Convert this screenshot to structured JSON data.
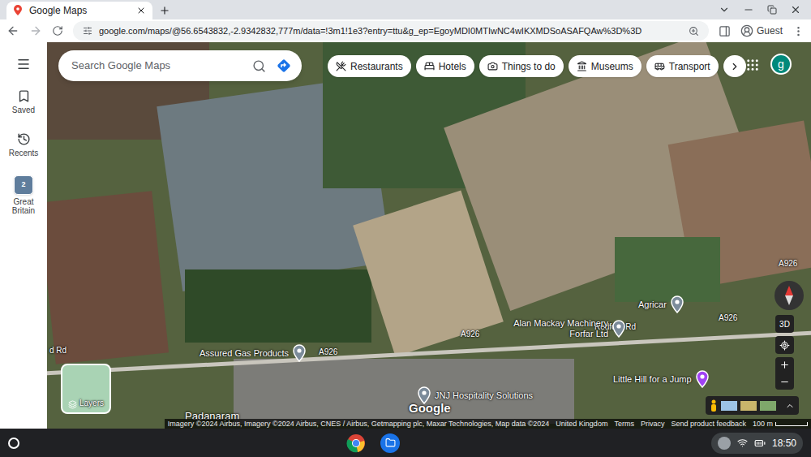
{
  "browser": {
    "tab_title": "Google Maps",
    "url": "google.com/maps/@56.6543832,-2.9342832,777m/data=!3m1!1e3?entry=ttu&g_ep=EgoyMDI0MTIwNC4wIKXMDSoASAFQAw%3D%3D",
    "profile": "Guest"
  },
  "sidebar": {
    "items": [
      {
        "label": "Saved",
        "kind": "saved"
      },
      {
        "label": "Recents",
        "kind": "recents"
      },
      {
        "label": "Great Britain",
        "kind": "place",
        "badge": "2"
      }
    ]
  },
  "search": {
    "placeholder": "Search Google Maps"
  },
  "chips": [
    {
      "label": "Restaurants"
    },
    {
      "label": "Hotels"
    },
    {
      "label": "Things to do"
    },
    {
      "label": "Museums"
    },
    {
      "label": "Transport"
    }
  ],
  "account_initial": "g",
  "places": [
    {
      "name": "Agricar",
      "color": "#7b8b9a"
    },
    {
      "name": "Alan Mackay Machinery Forfar Ltd",
      "color": "#7b8b9a"
    },
    {
      "name": "Assured Gas Products",
      "color": "#7b8b9a"
    },
    {
      "name": "JNJ Hospitality Solutions",
      "color": "#7b8b9a"
    },
    {
      "name": "Little Hill for a Jump",
      "color": "#a142f4"
    }
  ],
  "map_labels": [
    "d Rd",
    "A926",
    "A926",
    "A926",
    "A926",
    "Redford Rd",
    "Padanaram"
  ],
  "logo": "Google",
  "layers": "Layers",
  "view_3d": "3D",
  "footer": {
    "attribution": "Imagery ©2024 Airbus, Imagery ©2024 Airbus, CNES / Airbus, Getmapping plc, Maxar Technologies, Map data ©2024",
    "links": [
      "United Kingdom",
      "Terms",
      "Privacy",
      "Send product feedback"
    ],
    "scale": "100 m"
  },
  "taskbar": {
    "time": "18:50"
  }
}
